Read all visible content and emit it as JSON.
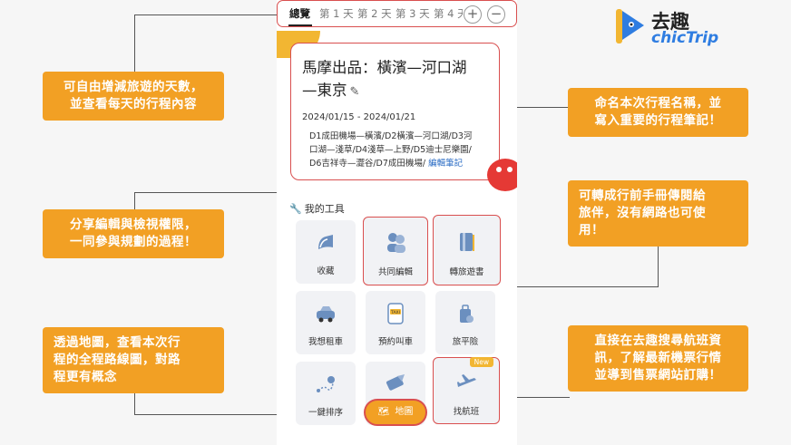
{
  "tabs": {
    "items": [
      {
        "label": "總覽",
        "active": true
      },
      {
        "label": "第 1 天"
      },
      {
        "label": "第 2 天"
      },
      {
        "label": "第 3 天"
      },
      {
        "label": "第 4 天"
      }
    ],
    "add_symbol": "+",
    "remove_symbol": "−"
  },
  "trip": {
    "title_line1": "馬摩出品：橫濱—河口湖",
    "title_line2": "—東京",
    "dates": "2024/01/15 - 2024/01/21",
    "notes_line1": "D1成田機場—橫濱/D2橫濱—河口湖/D3河",
    "notes_line2": "口湖—淺草/D4淺草—上野/D5迪士尼樂園/",
    "notes_line3": "D6吉祥寺—澀谷/D7成田機場/",
    "edit_notes_label": "編輯筆記"
  },
  "tools": {
    "header": "我的工具",
    "items": [
      {
        "label": "收藏",
        "icon": "bookmark-icon"
      },
      {
        "label": "共同編輯",
        "icon": "people-icon"
      },
      {
        "label": "轉旅遊書",
        "icon": "book-icon"
      },
      {
        "label": "我想租車",
        "icon": "car-icon"
      },
      {
        "label": "預約叫車",
        "icon": "taxi-icon"
      },
      {
        "label": "旅平險",
        "icon": "insurance-icon"
      },
      {
        "label": "一鍵排序",
        "icon": "route-sort-icon"
      },
      {
        "label": "",
        "icon": "ticket-icon"
      },
      {
        "label": "找航班",
        "icon": "airplane-icon",
        "badge": "New"
      }
    ],
    "map_button_label": "地圖"
  },
  "callouts": {
    "days": [
      "可自由增減旅遊的天數，",
      "並查看每天的行程內容"
    ],
    "share": [
      "分享編輯與檢視權限，",
      "一同參與規劃的過程！"
    ],
    "map": [
      "透過地圖，查看本次行",
      "程的全程路線圖，對路",
      "程更有概念"
    ],
    "rename": [
      "命名本次行程名稱，並",
      "寫入重要的行程筆記！"
    ],
    "book": [
      "可轉成行前手冊傳閱給",
      "旅伴，沒有網路也可使",
      "用！"
    ],
    "flight": [
      "直接在去趣搜尋航班資",
      "訊，了解最新機票行情",
      "並導到售票網站訂購！"
    ]
  },
  "logo": {
    "cn": "去趣",
    "en": "chicTrip"
  },
  "colors": {
    "accent": "#f2a024",
    "highlight": "#d94f4f",
    "link": "#2b6cc4",
    "brand_blue": "#2f7de1"
  }
}
